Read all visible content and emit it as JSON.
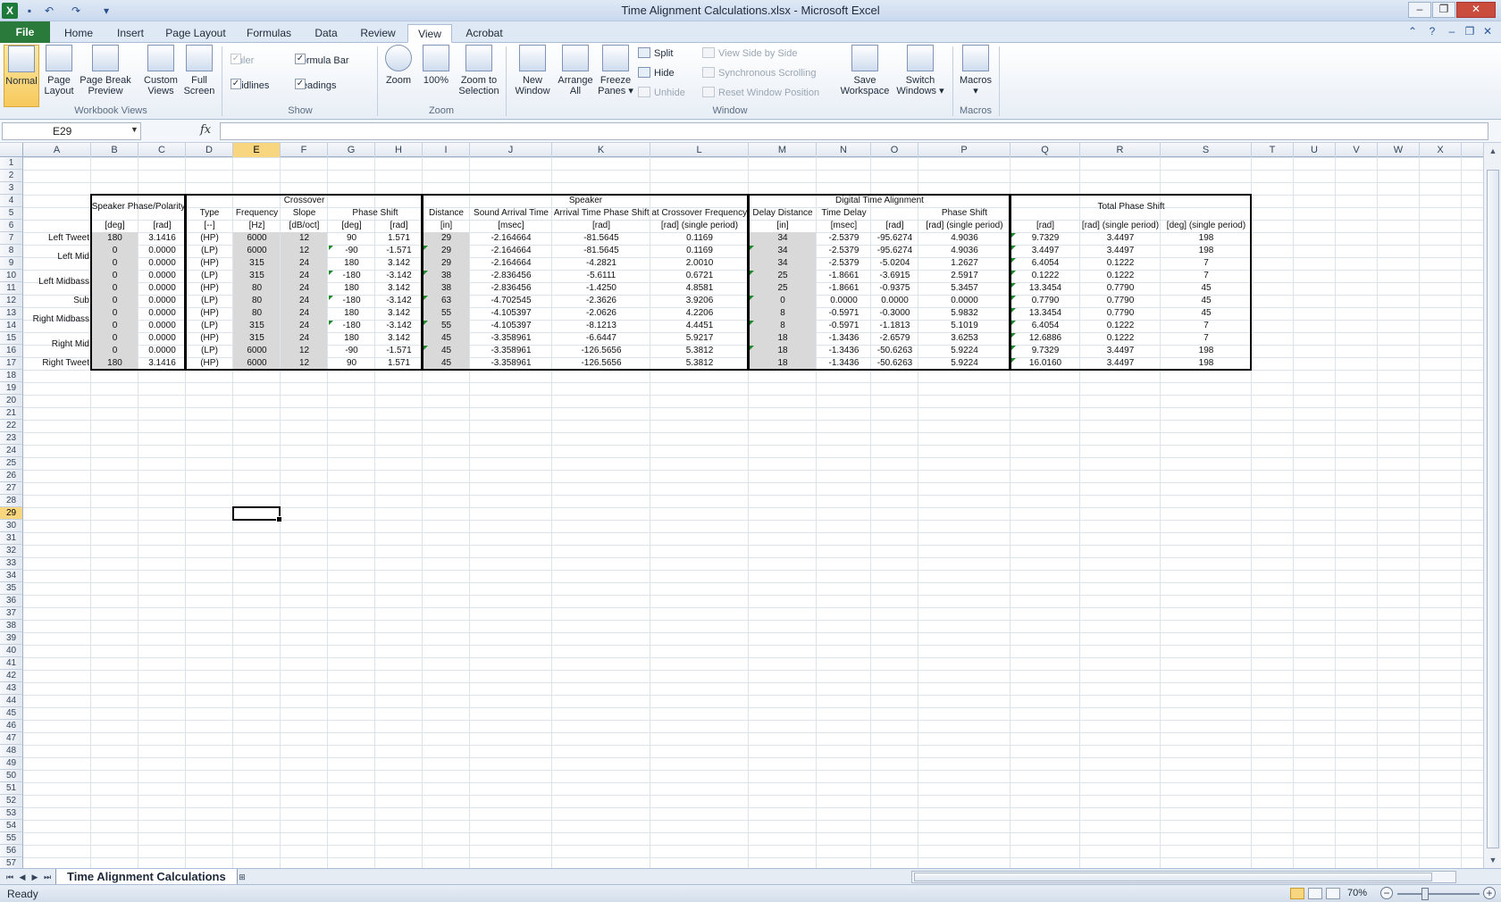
{
  "window": {
    "title": "Time Alignment Calculations.xlsx  -  Microsoft Excel",
    "logo_letter": "X",
    "qat": [
      "save-icon",
      "undo-icon",
      "redo-icon",
      "customize-icon"
    ],
    "controls": [
      "minimize-icon",
      "restore-icon",
      "close-icon"
    ]
  },
  "ribbon_tabs": [
    "File",
    "Home",
    "Insert",
    "Page Layout",
    "Formulas",
    "Data",
    "Review",
    "View",
    "Acrobat"
  ],
  "active_tab": "View",
  "ribbon": {
    "workbook_views": {
      "label": "Workbook Views",
      "buttons": [
        {
          "l1": "Normal",
          "l2": ""
        },
        {
          "l1": "Page",
          "l2": "Layout"
        },
        {
          "l1": "Page Break",
          "l2": "Preview"
        },
        {
          "l1": "Custom",
          "l2": "Views"
        },
        {
          "l1": "Full",
          "l2": "Screen"
        }
      ]
    },
    "show": {
      "label": "Show",
      "items": [
        "Ruler",
        "Formula Bar",
        "Gridlines",
        "Headings"
      ]
    },
    "zoom": {
      "label": "Zoom",
      "buttons": [
        {
          "l1": "Zoom",
          "l2": ""
        },
        {
          "l1": "100%",
          "l2": ""
        },
        {
          "l1": "Zoom to",
          "l2": "Selection"
        }
      ]
    },
    "window": {
      "label": "Window",
      "buttons": [
        {
          "l1": "New",
          "l2": "Window"
        },
        {
          "l1": "Arrange",
          "l2": "All"
        },
        {
          "l1": "Freeze",
          "l2": "Panes ▾"
        }
      ],
      "small": [
        "Split",
        "Hide",
        "Unhide",
        "View Side by Side",
        "Synchronous Scrolling",
        "Reset Window Position"
      ],
      "buttons2": [
        {
          "l1": "Save",
          "l2": "Workspace"
        },
        {
          "l1": "Switch",
          "l2": "Windows ▾"
        }
      ]
    },
    "macros": {
      "label": "Macros",
      "button": {
        "l1": "Macros",
        "l2": "▾"
      }
    }
  },
  "formula_bar": {
    "name_box": "E29",
    "fx": "fx",
    "formula": ""
  },
  "columns": [
    "A",
    "B",
    "C",
    "D",
    "E",
    "F",
    "G",
    "H",
    "I",
    "J",
    "K",
    "L",
    "M",
    "N",
    "O",
    "P",
    "Q",
    "R",
    "S",
    "T",
    "U",
    "V",
    "W",
    "X"
  ],
  "selected_cell": {
    "col": "E",
    "row": 29
  },
  "sheet": {
    "group_headers": {
      "speaker_phase": "Speaker Phase/Polarity",
      "crossover": "Crossover",
      "speaker": "Speaker",
      "digital_time_alignment": "Digital Time Alignment",
      "total_phase_shift": "Total Phase Shift"
    },
    "row5": {
      "D": "Type",
      "E": "Frequency",
      "F": "Slope",
      "GH": "Phase Shift",
      "I": "Distance",
      "J": "Sound Arrival Time",
      "KL": "Arrival Time Phase Shift at Crossover Frequency",
      "M": "Delay Distance",
      "N": "Time Delay",
      "P": "Phase Shift"
    },
    "units": [
      "[deg]",
      "[rad]",
      "[--]",
      "[Hz]",
      "[dB/oct]",
      "[deg]",
      "[rad]",
      "[in]",
      "[msec]",
      "[rad]",
      "[rad] (single period)",
      "[in]",
      "[msec]",
      "[rad]",
      "[rad] (single period)",
      "[rad]",
      "[rad] (single period)",
      "[deg] (single period)"
    ],
    "labels": [
      {
        "row": 7,
        "text": "Left Tweet"
      },
      {
        "row": 8.5,
        "text": "Left Mid"
      },
      {
        "row": 10.5,
        "text": "Left Midbass"
      },
      {
        "row": 12,
        "text": "Sub"
      },
      {
        "row": 13.5,
        "text": "Right Midbass"
      },
      {
        "row": 15.5,
        "text": "Right Mid"
      },
      {
        "row": 17,
        "text": "Right Tweet"
      }
    ],
    "rows": [
      [
        "180",
        "3.1416",
        "(HP)",
        "6000",
        "12",
        "90",
        "1.571",
        "29",
        "-2.164664",
        "-81.5645",
        "0.1169",
        "34",
        "-2.5379",
        "-95.6274",
        "4.9036",
        "9.7329",
        "3.4497",
        "198"
      ],
      [
        "0",
        "0.0000",
        "(LP)",
        "6000",
        "12",
        "-90",
        "-1.571",
        "29",
        "-2.164664",
        "-81.5645",
        "0.1169",
        "34",
        "-2.5379",
        "-95.6274",
        "4.9036",
        "3.4497",
        "3.4497",
        "198"
      ],
      [
        "0",
        "0.0000",
        "(HP)",
        "315",
        "24",
        "180",
        "3.142",
        "29",
        "-2.164664",
        "-4.2821",
        "2.0010",
        "34",
        "-2.5379",
        "-5.0204",
        "1.2627",
        "6.4054",
        "0.1222",
        "7"
      ],
      [
        "0",
        "0.0000",
        "(LP)",
        "315",
        "24",
        "-180",
        "-3.142",
        "38",
        "-2.836456",
        "-5.6111",
        "0.6721",
        "25",
        "-1.8661",
        "-3.6915",
        "2.5917",
        "0.1222",
        "0.1222",
        "7"
      ],
      [
        "0",
        "0.0000",
        "(HP)",
        "80",
        "24",
        "180",
        "3.142",
        "38",
        "-2.836456",
        "-1.4250",
        "4.8581",
        "25",
        "-1.8661",
        "-0.9375",
        "5.3457",
        "13.3454",
        "0.7790",
        "45"
      ],
      [
        "0",
        "0.0000",
        "(LP)",
        "80",
        "24",
        "-180",
        "-3.142",
        "63",
        "-4.702545",
        "-2.3626",
        "3.9206",
        "0",
        "0.0000",
        "0.0000",
        "0.0000",
        "0.7790",
        "0.7790",
        "45"
      ],
      [
        "0",
        "0.0000",
        "(HP)",
        "80",
        "24",
        "180",
        "3.142",
        "55",
        "-4.105397",
        "-2.0626",
        "4.2206",
        "8",
        "-0.5971",
        "-0.3000",
        "5.9832",
        "13.3454",
        "0.7790",
        "45"
      ],
      [
        "0",
        "0.0000",
        "(LP)",
        "315",
        "24",
        "-180",
        "-3.142",
        "55",
        "-4.105397",
        "-8.1213",
        "4.4451",
        "8",
        "-0.5971",
        "-1.1813",
        "5.1019",
        "6.4054",
        "0.1222",
        "7"
      ],
      [
        "0",
        "0.0000",
        "(HP)",
        "315",
        "24",
        "180",
        "3.142",
        "45",
        "-3.358961",
        "-6.6447",
        "5.9217",
        "18",
        "-1.3436",
        "-2.6579",
        "3.6253",
        "12.6886",
        "0.1222",
        "7"
      ],
      [
        "0",
        "0.0000",
        "(LP)",
        "6000",
        "12",
        "-90",
        "-1.571",
        "45",
        "-3.358961",
        "-126.5656",
        "5.3812",
        "18",
        "-1.3436",
        "-50.6263",
        "5.9224",
        "9.7329",
        "3.4497",
        "198"
      ],
      [
        "180",
        "3.1416",
        "(HP)",
        "6000",
        "12",
        "90",
        "1.571",
        "45",
        "-3.358961",
        "-126.5656",
        "5.3812",
        "18",
        "-1.3436",
        "-50.6263",
        "5.9224",
        "16.0160",
        "3.4497",
        "198"
      ]
    ]
  },
  "sheet_tab": "Time Alignment Calculations",
  "status": {
    "ready": "Ready",
    "zoom": "70%"
  }
}
